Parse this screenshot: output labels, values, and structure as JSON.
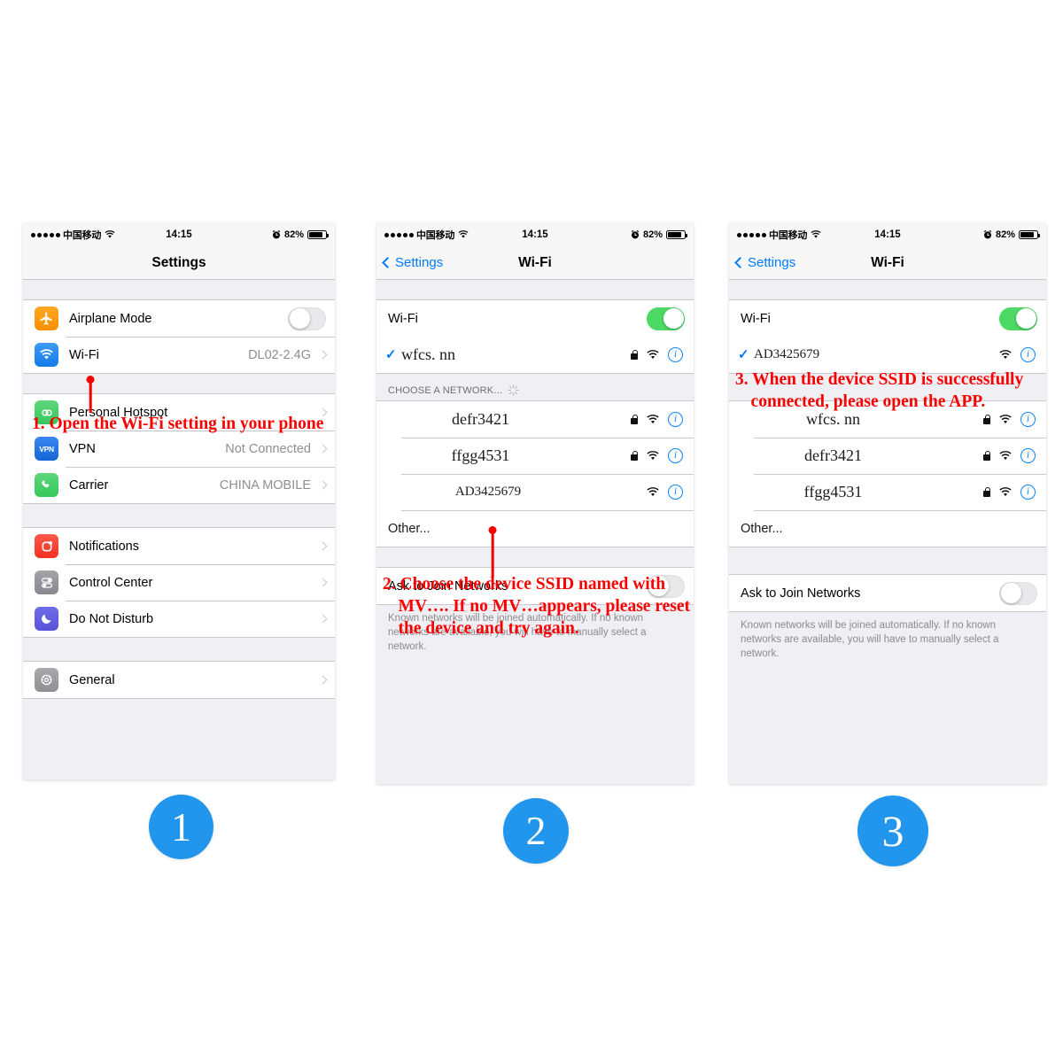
{
  "statusbar": {
    "carrier": "中国移动",
    "time": "14:15",
    "battery_pct": "82%",
    "alarm_icon": "alarm-icon",
    "wifi_icon": "wifi-icon",
    "signal_icon": "signal-dots-icon"
  },
  "phone1": {
    "nav_title": "Settings",
    "groups": [
      {
        "rows": [
          {
            "icon": "airplane-icon",
            "label": "Airplane Mode",
            "value": "",
            "accessory": "toggle-off"
          },
          {
            "icon": "wifi-icon",
            "label": "Wi-Fi",
            "value": "DL02-2.4G",
            "accessory": "chevron"
          }
        ]
      },
      {
        "rows": [
          {
            "icon": "hotspot-icon",
            "label": "Personal Hotspot",
            "value": "",
            "accessory": "chevron"
          },
          {
            "icon": "vpn-icon",
            "label": "VPN",
            "value": "Not Connected",
            "accessory": "chevron"
          },
          {
            "icon": "carrier-icon",
            "label": "Carrier",
            "value": "CHINA MOBILE",
            "accessory": "chevron"
          }
        ]
      },
      {
        "rows": [
          {
            "icon": "notifications-icon",
            "label": "Notifications",
            "value": "",
            "accessory": "chevron"
          },
          {
            "icon": "control-center-icon",
            "label": "Control Center",
            "value": "",
            "accessory": "chevron"
          },
          {
            "icon": "do-not-disturb-icon",
            "label": "Do Not Disturb",
            "value": "",
            "accessory": "chevron"
          }
        ]
      },
      {
        "rows": [
          {
            "icon": "general-icon",
            "label": "General",
            "value": "",
            "accessory": "chevron"
          }
        ]
      }
    ],
    "vpn_icon_text": "VPN",
    "annotation": "1. Open the Wi-Fi setting in your phone"
  },
  "phone2": {
    "nav_back": "Settings",
    "nav_title": "Wi-Fi",
    "wifi_row_label": "Wi-Fi",
    "wifi_toggle": "on",
    "connected_network": {
      "ssid": "wfcs. nn",
      "checked": true,
      "lock": true,
      "wifi": true,
      "info": true
    },
    "section_header": "CHOOSE A NETWORK...",
    "networks": [
      {
        "ssid": "defr3421",
        "lock": true,
        "wifi": true,
        "info": true
      },
      {
        "ssid": "ffgg4531",
        "lock": true,
        "wifi": true,
        "info": true
      },
      {
        "ssid": "AD3425679",
        "lock": false,
        "wifi": true,
        "info": true
      }
    ],
    "other_label": "Other...",
    "ask_to_join_label": "Ask to Join Networks",
    "ask_to_join_toggle": "off",
    "footnote": "Known networks will be joined automatically. If no known networks are available, you will have to manually select a network.",
    "annotation": "2. Choose the device SSID named with MV…. If no MV…appears, please reset the device and try again."
  },
  "phone3": {
    "nav_back": "Settings",
    "nav_title": "Wi-Fi",
    "wifi_row_label": "Wi-Fi",
    "wifi_toggle": "on",
    "connected_network": {
      "ssid": "AD3425679",
      "checked": true,
      "lock": false,
      "wifi": true,
      "info": true
    },
    "networks": [
      {
        "ssid": "wfcs. nn",
        "lock": true,
        "wifi": true,
        "info": true
      },
      {
        "ssid": "defr3421",
        "lock": true,
        "wifi": true,
        "info": true
      },
      {
        "ssid": "ffgg4531",
        "lock": true,
        "wifi": true,
        "info": true
      }
    ],
    "other_label": "Other...",
    "ask_to_join_label": "Ask to Join Networks",
    "ask_to_join_toggle": "off",
    "footnote": "Known networks will be joined automatically. If no known networks are available, you will have to manually select a network.",
    "annotation": "3. When the device SSID is successfully connected, please open the APP."
  },
  "badges": {
    "one": "1",
    "two": "2",
    "three": "3"
  },
  "colors": {
    "badge_blue": "#2196ec",
    "annotation_red": "#fc0000",
    "ios_blue": "#007aff",
    "toggle_green": "#4cd964",
    "list_bg": "#efeff4"
  }
}
